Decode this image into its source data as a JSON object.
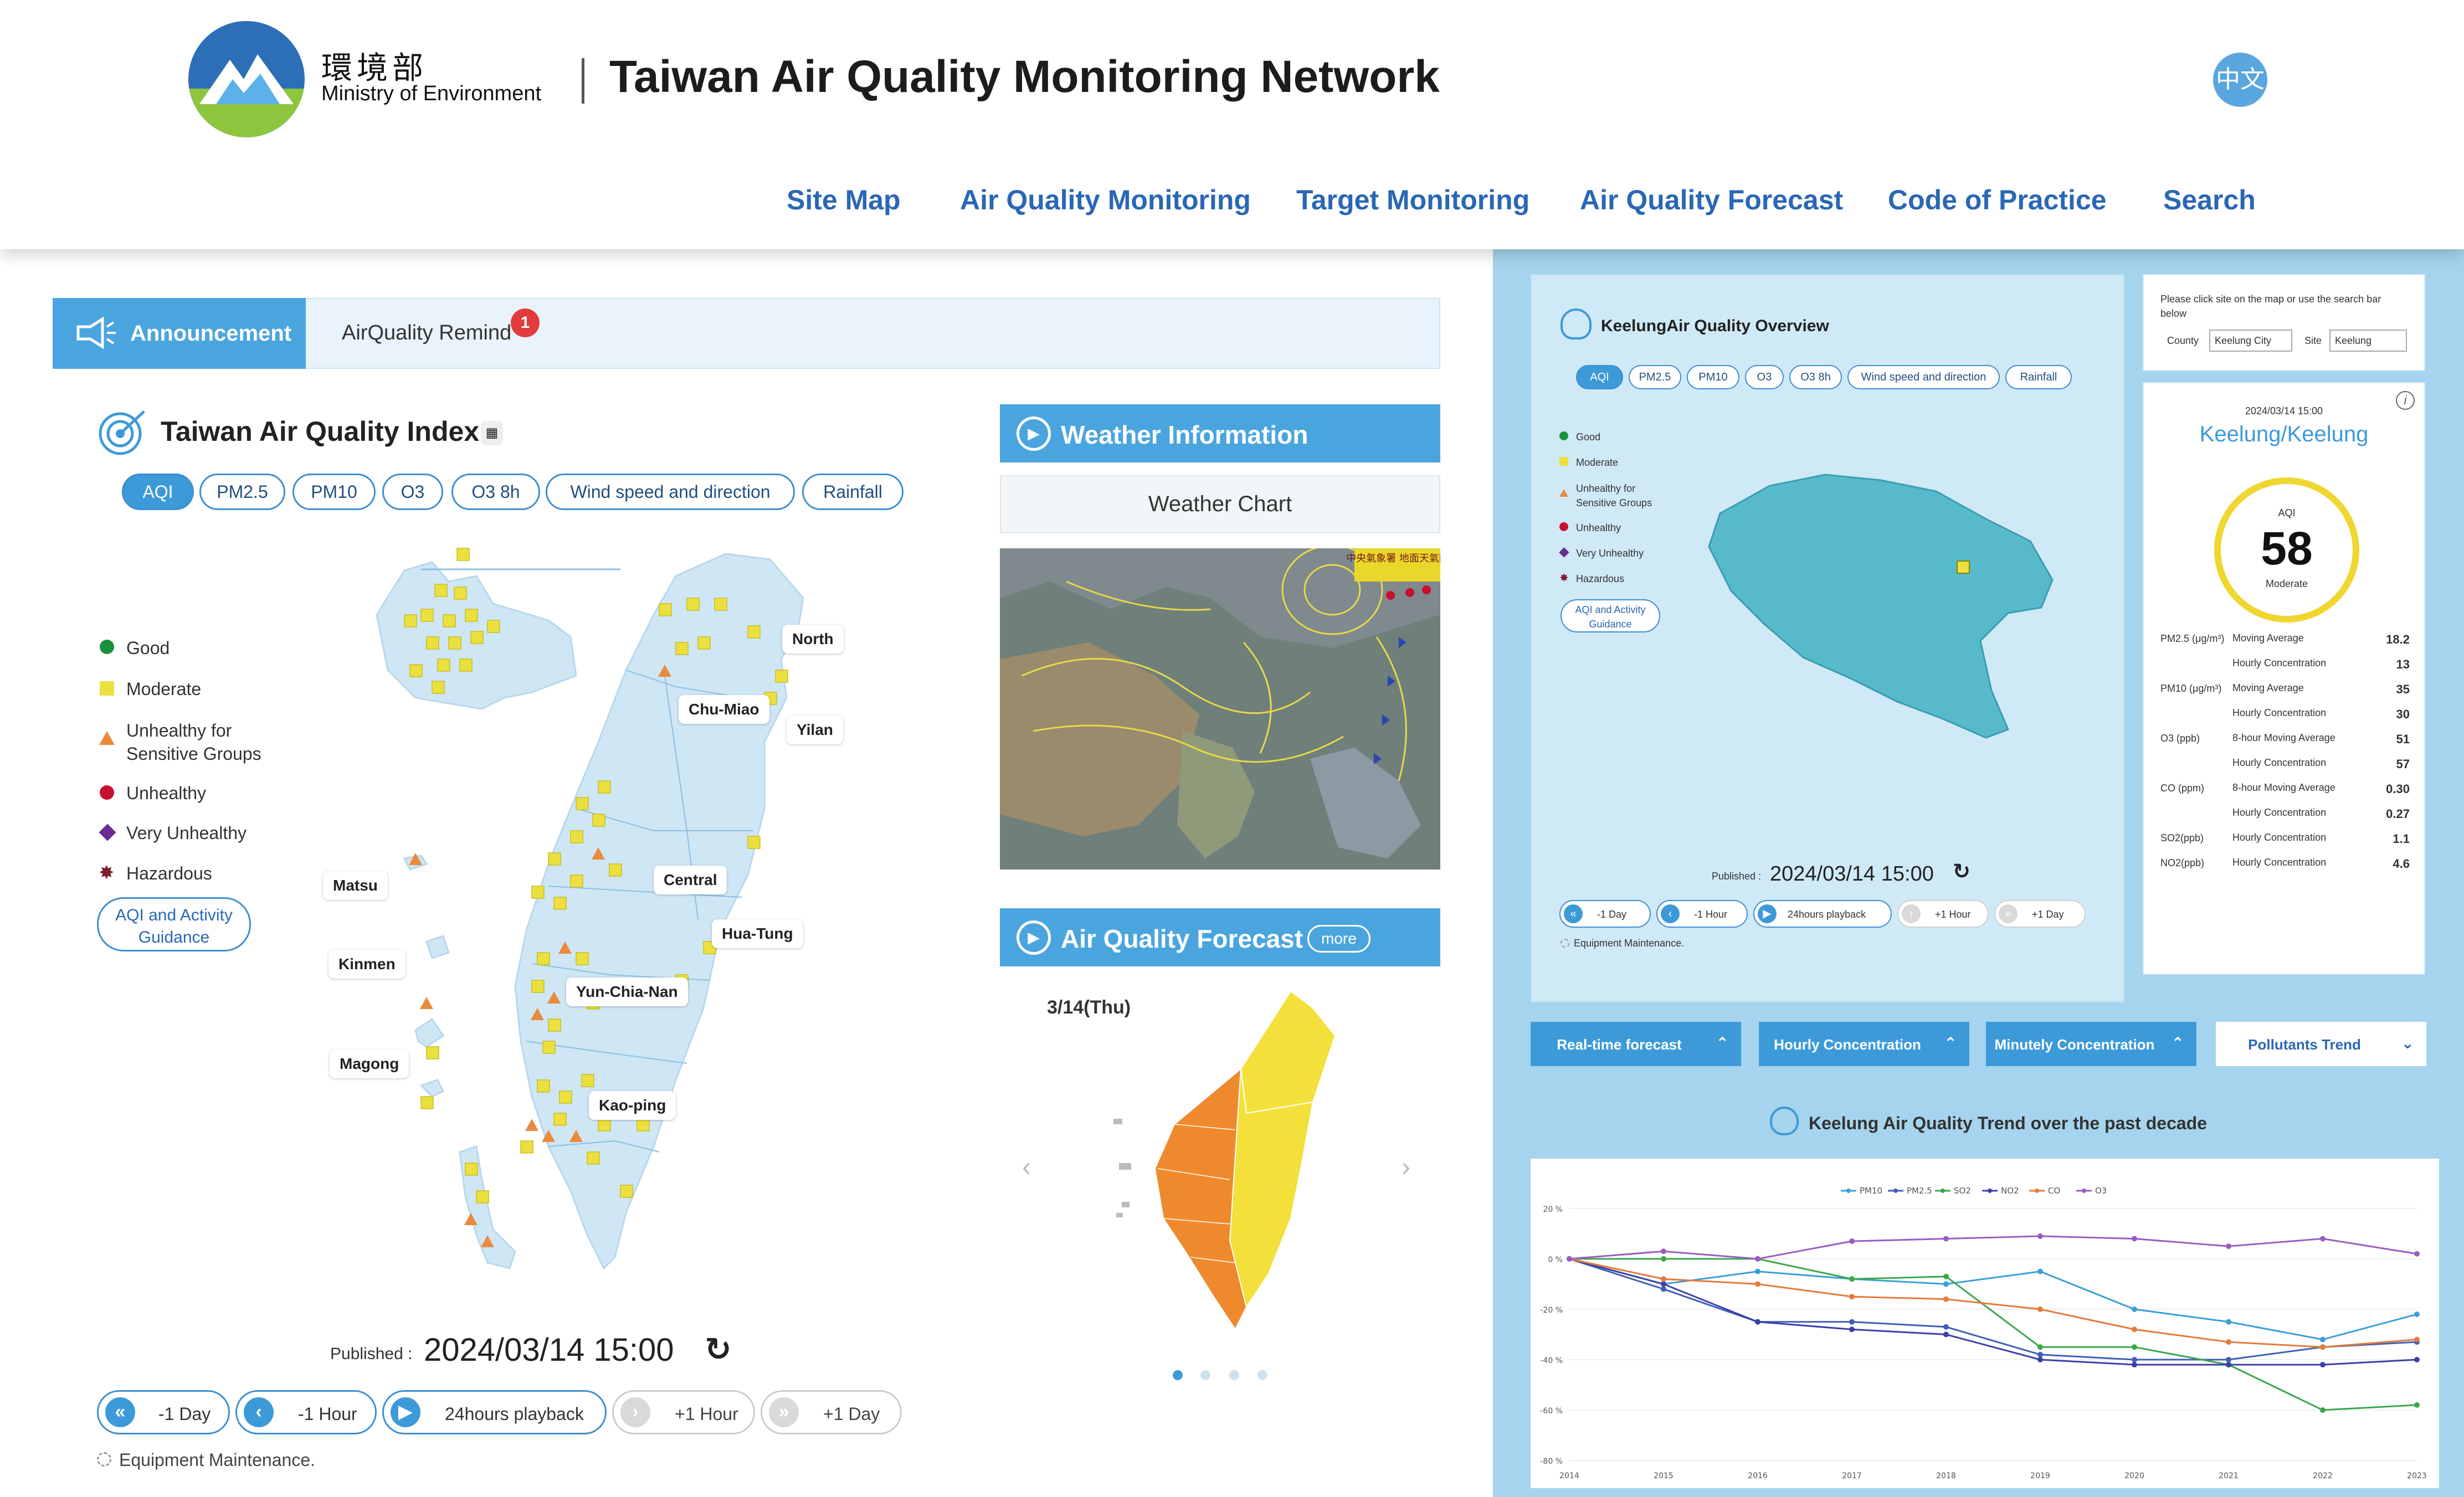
{
  "header": {
    "org_cn": "環境部",
    "org_en": "Ministry of Environment",
    "title": "Taiwan Air Quality Monitoring Network",
    "lang_button": "中文",
    "nav": [
      "Site Map",
      "Air Quality Monitoring",
      "Target Monitoring",
      "Air Quality Forecast",
      "Code of Practice",
      "Search"
    ]
  },
  "tabs": {
    "announcement": "Announcement",
    "remind": "AirQuality Remind",
    "remind_badge": "1"
  },
  "aqi_section": {
    "title": "Taiwan Air Quality Index",
    "pollutant_tabs": [
      "AQI",
      "PM2.5",
      "PM10",
      "O3",
      "O3 8h",
      "Wind speed and direction",
      "Rainfall"
    ],
    "legend": [
      {
        "label": "Good",
        "color": "#1a8f3c",
        "shape": "circle"
      },
      {
        "label": "Moderate",
        "color": "#ece03f",
        "shape": "square"
      },
      {
        "label": "Unhealthy for Sensitive Groups",
        "color": "#e98a3d",
        "shape": "triangle"
      },
      {
        "label": "Unhealthy",
        "color": "#c8102e",
        "shape": "circle"
      },
      {
        "label": "Very Unhealthy",
        "color": "#6a2c91",
        "shape": "diamond"
      },
      {
        "label": "Hazardous",
        "color": "#7e1f2f",
        "shape": "star"
      }
    ],
    "guidance_button": "AQI and Activity Guidance",
    "map_labels": [
      "North",
      "Chu-Miao",
      "Yilan",
      "Central",
      "Hua-Tung",
      "Yun-Chia-Nan",
      "Kao-ping",
      "Matsu",
      "Kinmen",
      "Magong"
    ],
    "published_label": "Published :",
    "published": "2024/03/14 15:00",
    "controls": [
      "-1 Day",
      "-1 Hour",
      "24hours playback",
      "+1 Hour",
      "+1 Day"
    ],
    "maintenance": "Equipment Maintenance."
  },
  "weather": {
    "title": "Weather Information",
    "tab": "Weather Chart",
    "chart_text": "中央氣象署 地面天氣圖"
  },
  "forecast": {
    "title": "Air Quality Forecast",
    "more": "more",
    "date": "3/14(Thu)",
    "page_dots": 4,
    "active_dot": 1
  },
  "overview": {
    "title": "KeelungAir Quality Overview",
    "tabs": [
      "AQI",
      "PM2.5",
      "PM10",
      "O3",
      "O3 8h",
      "Wind speed and direction",
      "Rainfall"
    ],
    "legend": [
      "Good",
      "Moderate",
      "Unhealthy for Sensitive Groups",
      "Unhealthy",
      "Very Unhealthy",
      "Hazardous"
    ],
    "guidance_button": "AQI and Activity Guidance",
    "published_label": "Published :",
    "published": "2024/03/14 15:00",
    "controls": [
      "-1 Day",
      "-1 Hour",
      "24hours playback",
      "+1 Hour",
      "+1 Day"
    ],
    "maintenance": "Equipment Maintenance."
  },
  "site_select": {
    "hint": "Please click site on the map or use the search bar below",
    "county_label": "County",
    "county_value": "Keelung City",
    "site_label": "Site",
    "site_value": "Keelung"
  },
  "aqi_card": {
    "time": "2024/03/14 15:00",
    "station": "Keelung/Keelung",
    "aqi_label": "AQI",
    "aqi_value": "58",
    "status": "Moderate",
    "rows": [
      {
        "pollutant": "PM2.5",
        "unit": "(μg/m³)",
        "metric": "Moving Average",
        "value": "18.2"
      },
      {
        "pollutant": "",
        "unit": "",
        "metric": "Hourly Concentration",
        "value": "13"
      },
      {
        "pollutant": "PM10",
        "unit": "(μg/m³)",
        "metric": "Moving Average",
        "value": "35"
      },
      {
        "pollutant": "",
        "unit": "",
        "metric": "Hourly Concentration",
        "value": "30"
      },
      {
        "pollutant": "O3",
        "unit": "(ppb)",
        "metric": "8-hour Moving Average",
        "value": "51"
      },
      {
        "pollutant": "",
        "unit": "",
        "metric": "Hourly Concentration",
        "value": "57"
      },
      {
        "pollutant": "CO",
        "unit": "(ppm)",
        "metric": "8-hour Moving Average",
        "value": "0.30"
      },
      {
        "pollutant": "",
        "unit": "",
        "metric": "Hourly Concentration",
        "value": "0.27"
      },
      {
        "pollutant": "SO2(ppb)",
        "unit": "",
        "metric": "Hourly Concentration",
        "value": "1.1"
      },
      {
        "pollutant": "NO2(ppb)",
        "unit": "",
        "metric": "Hourly Concentration",
        "value": "4.6"
      }
    ]
  },
  "bottom_buttons": [
    "Real-time forecast",
    "Hourly Concentration",
    "Minutely Concentration",
    "Pollutants Trend"
  ],
  "trend": {
    "title": "Keelung Air Quality Trend over the past decade"
  },
  "chart_data": {
    "type": "line",
    "title": "",
    "x": [
      "2014",
      "2015",
      "2016",
      "2017",
      "2018",
      "2019",
      "2020",
      "2021",
      "2022",
      "2023"
    ],
    "yticks": [
      "20 %",
      "0 %",
      "-20 %",
      "-40 %",
      "-60 %",
      "-80 %"
    ],
    "ylim": [
      -80,
      20
    ],
    "series": [
      {
        "name": "PM10",
        "color": "#3a9fd6",
        "values": [
          0,
          -10,
          -5,
          -8,
          -10,
          -5,
          -20,
          -25,
          -32,
          -22
        ]
      },
      {
        "name": "PM2.5",
        "color": "#3f5fb8",
        "values": [
          0,
          -12,
          -25,
          -25,
          -27,
          -38,
          -40,
          -40,
          -35,
          -33
        ]
      },
      {
        "name": "SO2",
        "color": "#3aa84a",
        "values": [
          0,
          0,
          0,
          -8,
          -7,
          -35,
          -35,
          -42,
          -60,
          -58
        ]
      },
      {
        "name": "NO2",
        "color": "#3d3fa8",
        "values": [
          0,
          -10,
          -25,
          -28,
          -30,
          -40,
          -42,
          -42,
          -42,
          -40
        ]
      },
      {
        "name": "CO",
        "color": "#e57a3a",
        "values": [
          0,
          -8,
          -10,
          -15,
          -16,
          -20,
          -28,
          -33,
          -35,
          -32
        ]
      },
      {
        "name": "O3",
        "color": "#9a5cc1",
        "values": [
          0,
          3,
          0,
          7,
          8,
          9,
          8,
          5,
          8,
          2
        ]
      }
    ]
  }
}
